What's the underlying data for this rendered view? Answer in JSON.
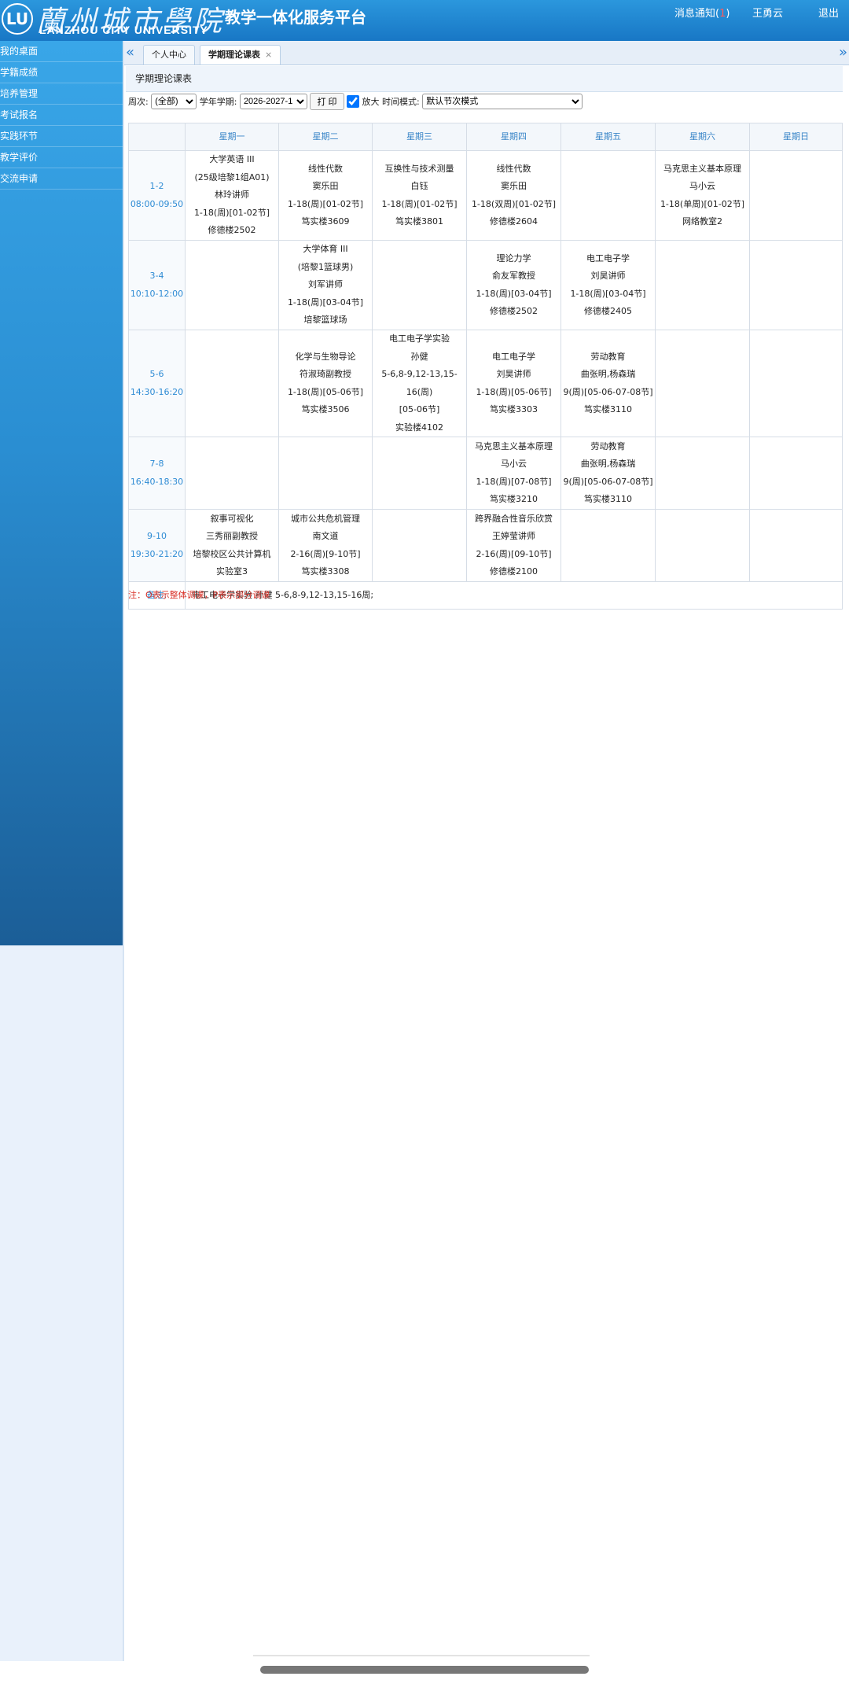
{
  "header": {
    "logo_mark": "LU",
    "logo_cn": "蘭州城市學院",
    "logo_en": "LANZHOU CITY UNIVERSITY",
    "platform_title": "教学一体化服务平台",
    "messages_label": "消息通知(",
    "messages_count": "1",
    "messages_close": ")",
    "user_name": "王勇云",
    "logout_label": "退出"
  },
  "sidebar": {
    "items": [
      {
        "label": "我的桌面"
      },
      {
        "label": "学籍成绩"
      },
      {
        "label": "培养管理"
      },
      {
        "label": "考试报名"
      },
      {
        "label": "实践环节"
      },
      {
        "label": "教学评价"
      },
      {
        "label": "交流申请"
      }
    ]
  },
  "tabs": {
    "prev_icon": "«",
    "next_icon": "»",
    "items": [
      {
        "label": "个人中心"
      },
      {
        "label": "学期理论课表",
        "close": "×"
      }
    ]
  },
  "page": {
    "title": "学期理论课表"
  },
  "filters": {
    "week_label": "周次:",
    "week_value": "(全部)",
    "term_label": "学年学期:",
    "term_value": "2026-2027-1",
    "print_label": "打 印",
    "zoom_label": "放大",
    "mode_label": "时间模式:",
    "mode_value": "默认节次模式"
  },
  "timetable": {
    "days": [
      "星期一",
      "星期二",
      "星期三",
      "星期四",
      "星期五",
      "星期六",
      "星期日"
    ],
    "rows": [
      {
        "slot": "1-2",
        "time": "08:00-09:50",
        "cells": [
          [
            "大学英语 III",
            "(25级培黎1组A01)",
            "林玲讲师",
            "1-18(周)[01-02节]",
            "修德楼2502"
          ],
          [
            "线性代数",
            "窦乐田",
            "1-18(周)[01-02节]",
            "笃实楼3609"
          ],
          [
            "互换性与技术测量",
            "白钰",
            "1-18(周)[01-02节]",
            "笃实楼3801"
          ],
          [
            "线性代数",
            "窦乐田",
            "1-18(双周)[01-02节]",
            "修德楼2604"
          ],
          [],
          [
            "马克思主义基本原理",
            "马小云",
            "1-18(单周)[01-02节]",
            "网络教室2"
          ],
          []
        ]
      },
      {
        "slot": "3-4",
        "time": "10:10-12:00",
        "cells": [
          [],
          [
            "大学体育 III",
            "(培黎1篮球男)",
            "刘军讲师",
            "1-18(周)[03-04节]",
            "培黎篮球场"
          ],
          [],
          [
            "理论力学",
            "俞友军教授",
            "1-18(周)[03-04节]",
            "修德楼2502"
          ],
          [
            "电工电子学",
            "刘昊讲师",
            "1-18(周)[03-04节]",
            "修德楼2405"
          ],
          [],
          []
        ]
      },
      {
        "slot": "5-6",
        "time": "14:30-16:20",
        "cells": [
          [],
          [
            "化学与生物导论",
            "符淑琦副教授",
            "1-18(周)[05-06节]",
            "笃实楼3506"
          ],
          [
            "电工电子学实验",
            "孙健",
            "5-6,8-9,12-13,15-16(周)",
            "[05-06节]",
            "实验楼4102"
          ],
          [
            "电工电子学",
            "刘昊讲师",
            "1-18(周)[05-06节]",
            "笃实楼3303"
          ],
          [
            "劳动教育",
            "曲张明,杨森瑞",
            "9(周)[05-06-07-08节]",
            "笃实楼3110"
          ],
          [],
          []
        ]
      },
      {
        "slot": "7-8",
        "time": "16:40-18:30",
        "cells": [
          [],
          [],
          [],
          [
            "马克思主义基本原理",
            "马小云",
            "1-18(周)[07-08节]",
            "笃实楼3210"
          ],
          [
            "劳动教育",
            "曲张明,杨森瑞",
            "9(周)[05-06-07-08节]",
            "笃实楼3110"
          ],
          [],
          []
        ]
      },
      {
        "slot": "9-10",
        "time": "19:30-21:20",
        "cells": [
          [
            "叙事可视化",
            "三秀丽副教授",
            "培黎校区公共计算机",
            "实验室3"
          ],
          [
            "城市公共危机管理",
            "南文道",
            "2-16(周)[9-10节]",
            "笃实楼3308"
          ],
          [],
          [
            "跨界融合性音乐欣赏",
            "王婷莹讲师",
            "2-16(周)[09-10节]",
            "修德楼2100"
          ],
          [],
          [],
          []
        ]
      }
    ],
    "remark_label": "备注:",
    "remark_text": "电工电子学实验 孙健 5-6,8-9,12-13,15-16周;"
  },
  "note": "注：O表示整体调课，P表示部分调课",
  "colors": {
    "header_bg": "#1f86d4",
    "accent": "#2e8bd4",
    "note_red": "#d9342b"
  }
}
